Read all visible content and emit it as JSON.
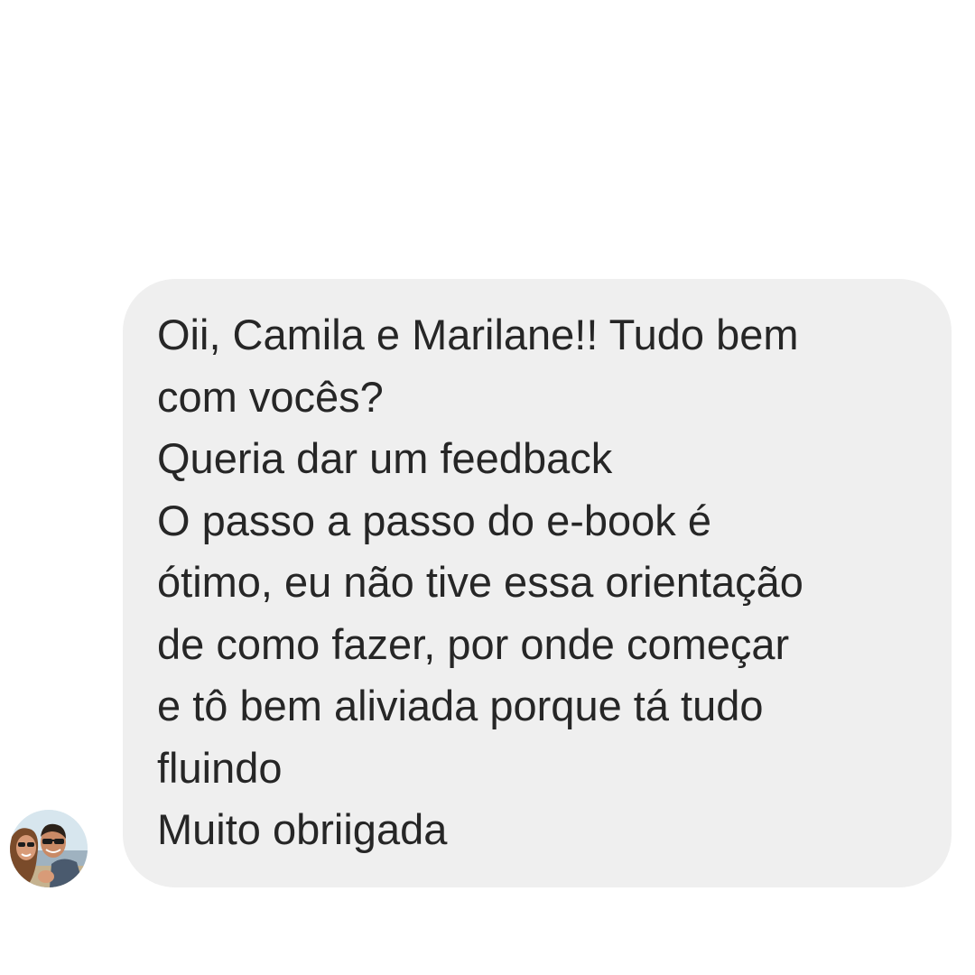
{
  "conversation": {
    "message": {
      "lines": [
        "Oii, Camila e Marilane!! Tudo bem",
        "com vocês?",
        "Queria dar um feedback",
        "O passo a passo do e-book é",
        "ótimo, eu não tive essa orientação",
        "de como fazer, por onde começar",
        "e tô bem aliviada porque tá tudo",
        "fluindo",
        "Muito obriigada"
      ]
    },
    "sender": {
      "avatar_icon": "profile-photo-avatar"
    }
  },
  "colors": {
    "background": "#ffffff",
    "bubble": "#efefef",
    "text": "#262626"
  }
}
